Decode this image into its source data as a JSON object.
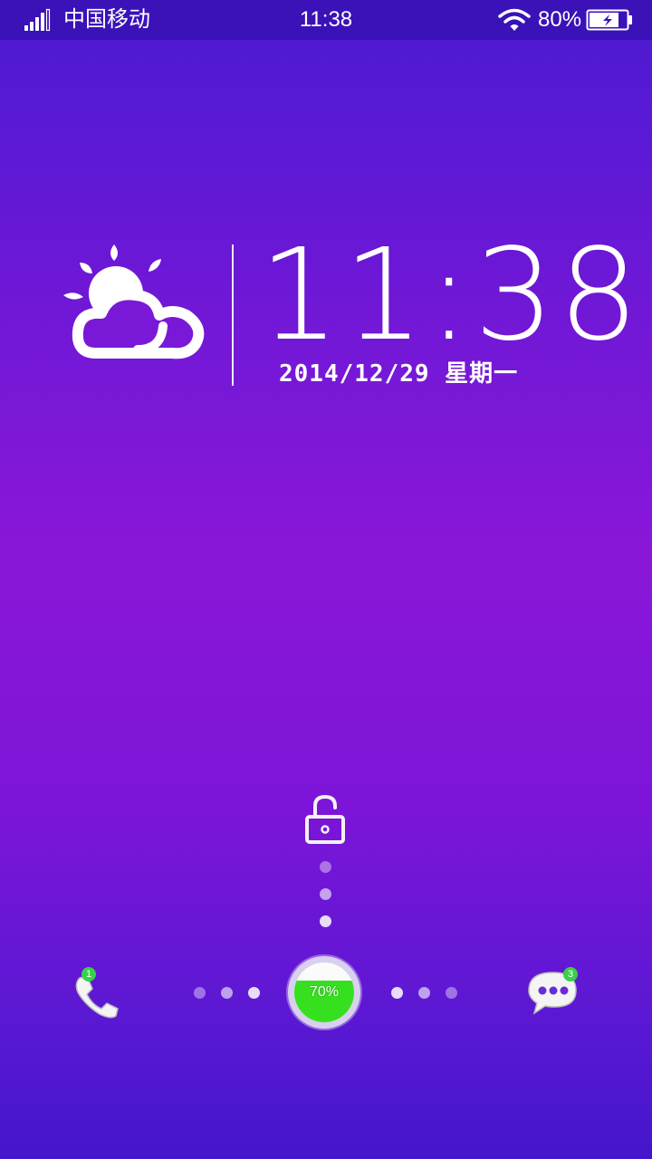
{
  "status_bar": {
    "carrier": "中国移动",
    "time": "11:38",
    "battery_percent": "80%",
    "battery_level": 0.8,
    "icons": [
      "signal-icon",
      "wifi-icon",
      "battery-charging-icon"
    ]
  },
  "lockscreen": {
    "clock": "11:38",
    "date": "2014/12/29 星期一",
    "weather_icon": "partly-cloudy-icon",
    "unlock_icon": "unlocked-padlock-icon"
  },
  "dock": {
    "phone": {
      "icon": "phone-icon",
      "badge": "1"
    },
    "messages": {
      "icon": "message-bubble-icon",
      "badge": "3"
    },
    "battery": {
      "label": "70%",
      "level": 0.7,
      "fill_color": "#36e01f"
    }
  },
  "colors": {
    "background_top": "#4a1bd0",
    "background_mid": "#8a17d8",
    "status_bar": "#3a12b8",
    "badge": "#39d04a"
  }
}
